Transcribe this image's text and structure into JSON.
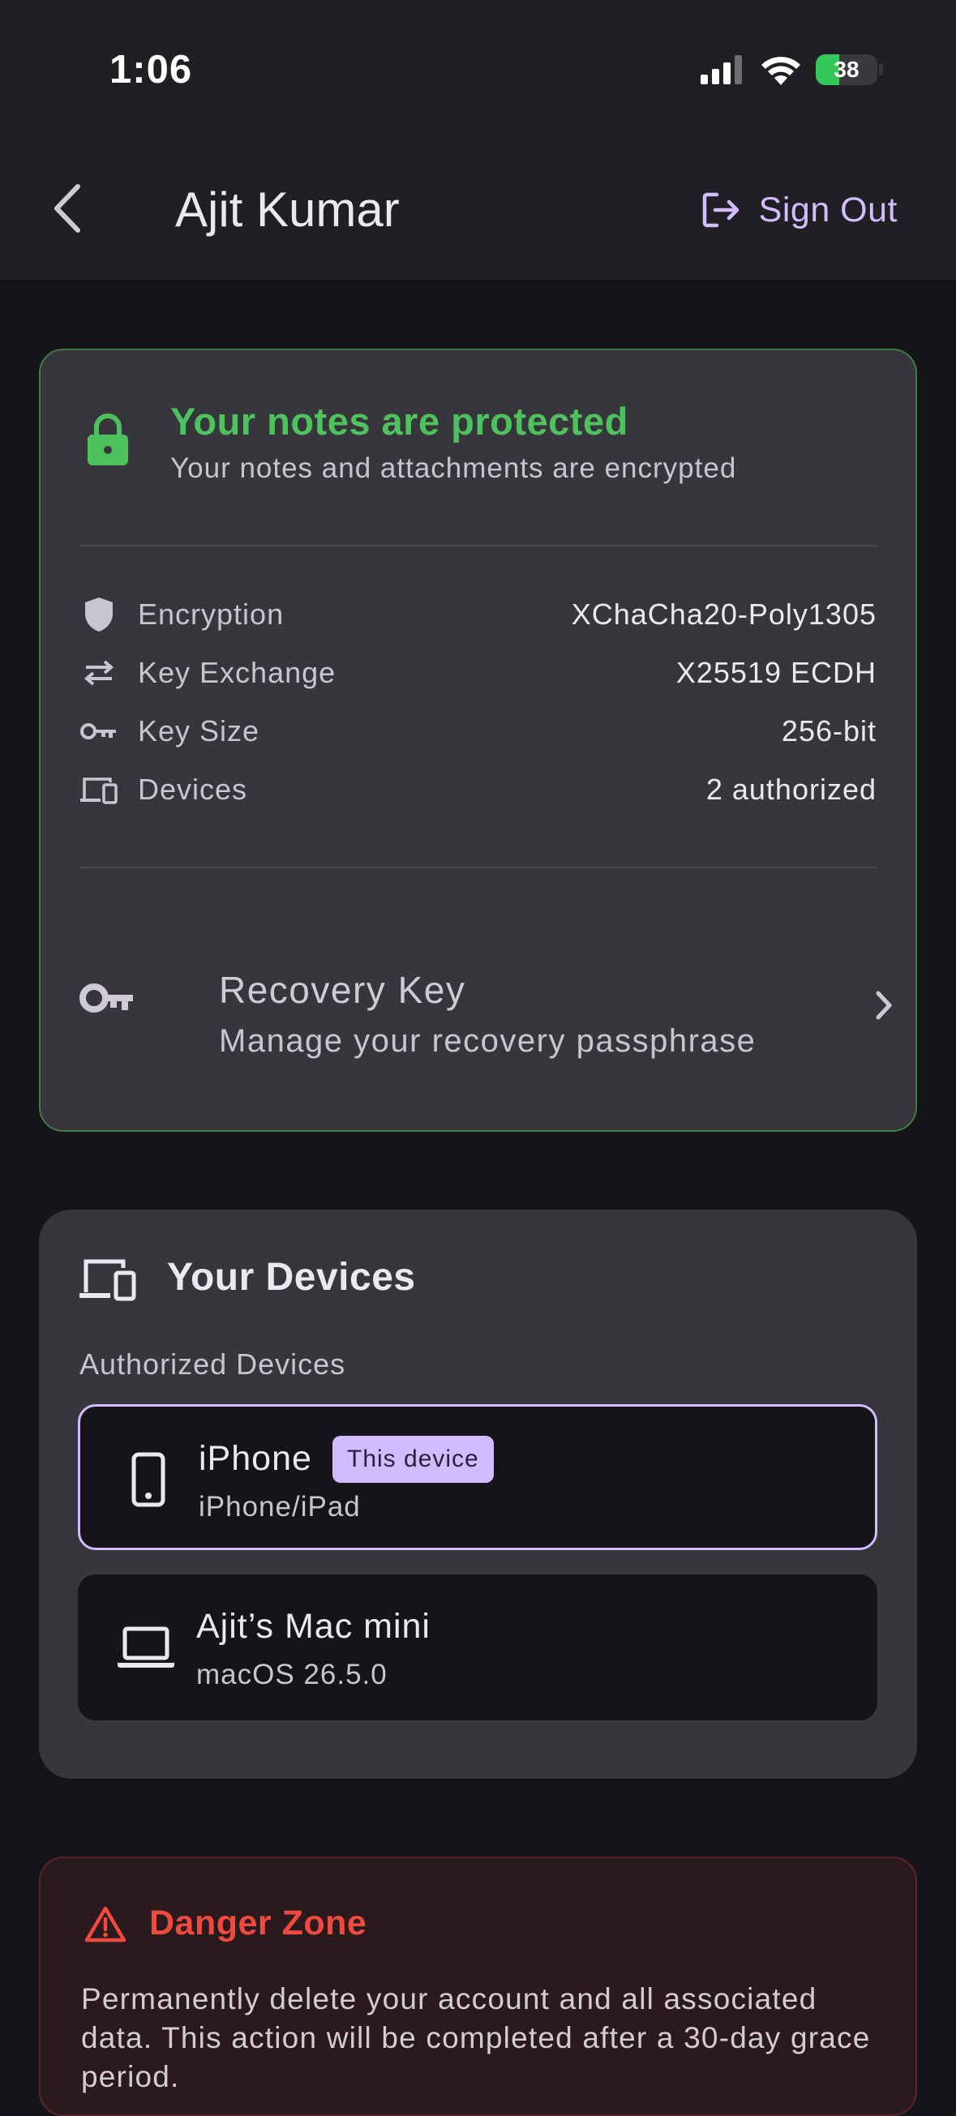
{
  "status_bar": {
    "time": "1:06",
    "battery_percent": 38,
    "battery_label": "38",
    "icons": [
      "cellular-signal-icon",
      "wifi-icon",
      "battery-charging-icon"
    ]
  },
  "header": {
    "title": "Ajit Kumar",
    "back_icon": "chevron-left-icon",
    "sign_out_label": "Sign Out",
    "sign_out_icon": "logout-icon"
  },
  "security": {
    "title": "Your notes are protected",
    "subtitle": "Your notes and attachments are encrypted",
    "specs": [
      {
        "icon": "shield-icon",
        "label": "Encryption",
        "value": "XChaCha20-Poly1305"
      },
      {
        "icon": "swap-arrows-icon",
        "label": "Key Exchange",
        "value": "X25519 ECDH"
      },
      {
        "icon": "key-icon",
        "label": "Key Size",
        "value": "256-bit"
      },
      {
        "icon": "devices-icon",
        "label": "Devices",
        "value": "2 authorized"
      }
    ],
    "recovery": {
      "title": "Recovery Key",
      "subtitle": "Manage your recovery passphrase"
    }
  },
  "devices": {
    "title": "Your Devices",
    "subtitle": "Authorized Devices",
    "items": [
      {
        "name": "iPhone",
        "type": "iPhone/iPad",
        "badge": "This device",
        "icon": "phone-icon"
      },
      {
        "name": "Ajit’s Mac mini",
        "type": "macOS 26.5.0",
        "icon": "laptop-icon"
      }
    ]
  },
  "danger_zone": {
    "title": "Danger Zone",
    "text": "Permanently delete your account and all associated data. This action will be completed after a 30-day grace period."
  },
  "colors": {
    "background": "#151419",
    "header_background": "#201f24",
    "card": "#37363d",
    "accent": "#d3bcfd",
    "success": "#4ec25d",
    "danger": "#ef4a3f"
  }
}
